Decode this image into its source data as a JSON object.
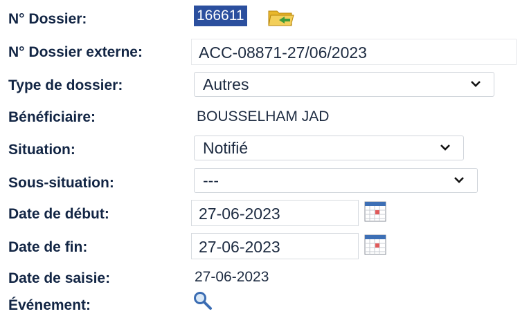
{
  "dossier": {
    "numero_label": "N° Dossier:",
    "numero_value": "166611",
    "externe_label": "N° Dossier externe:",
    "externe_value": "ACC-08871-27/06/2023",
    "type_label": "Type de dossier:",
    "type_value": "Autres",
    "beneficiaire_label": "Bénéficiaire:",
    "beneficiaire_value": "BOUSSELHAM JAD",
    "situation_label": "Situation:",
    "situation_value": "Notifié",
    "sous_situation_label": "Sous-situation:",
    "sous_situation_value": "---",
    "date_debut_label": "Date de début:",
    "date_debut_value": "27-06-2023",
    "date_fin_label": "Date de fin:",
    "date_fin_value": "27-06-2023",
    "date_saisie_label": "Date de saisie:",
    "date_saisie_value": "27-06-2023",
    "evenement_label": "Événement:"
  },
  "icons": {
    "folder": "folder-open-icon",
    "calendar": "calendar-icon",
    "search": "search-icon",
    "dropdown": "chevron-down-icon"
  },
  "colors": {
    "label": "#122544",
    "selection": "#2b4f9e",
    "folder": "#e8b72c",
    "arrow": "#3f9b3a"
  }
}
